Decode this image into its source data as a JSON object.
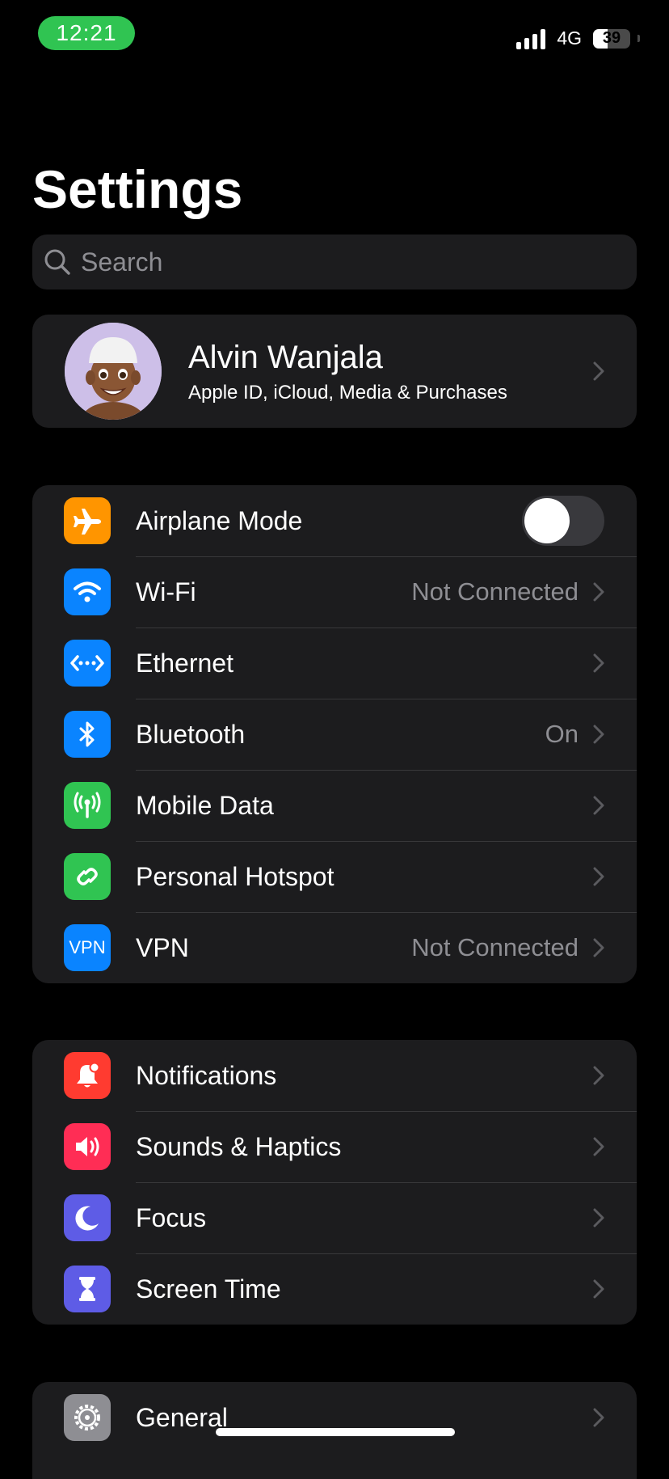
{
  "status_bar": {
    "time": "12:21",
    "network": "4G",
    "battery": "39",
    "battery_level": 0.39,
    "signal_bars": 4
  },
  "title": "Settings",
  "search": {
    "placeholder": "Search"
  },
  "profile": {
    "name": "Alvin Wanjala",
    "subtitle": "Apple ID, iCloud, Media & Purchases"
  },
  "connectivity": [
    {
      "label": "Airplane Mode",
      "value": "",
      "icon": "airplane-icon",
      "color": "#ff9500",
      "toggle": false
    },
    {
      "label": "Wi-Fi",
      "value": "Not Connected",
      "icon": "wifi-icon",
      "color": "#0a84ff"
    },
    {
      "label": "Ethernet",
      "value": "",
      "icon": "ethernet-icon",
      "color": "#0a84ff"
    },
    {
      "label": "Bluetooth",
      "value": "On",
      "icon": "bluetooth-icon",
      "color": "#0a84ff"
    },
    {
      "label": "Mobile Data",
      "value": "",
      "icon": "antenna-icon",
      "color": "#30c452"
    },
    {
      "label": "Personal Hotspot",
      "value": "",
      "icon": "hotspot-icon",
      "color": "#30c452"
    },
    {
      "label": "VPN",
      "value": "Not Connected",
      "icon": "vpn-icon",
      "icon_text": "VPN",
      "color": "#0a84ff"
    }
  ],
  "attention": [
    {
      "label": "Notifications",
      "icon": "bell-icon",
      "color": "#ff3b30"
    },
    {
      "label": "Sounds & Haptics",
      "icon": "speaker-icon",
      "color": "#ff2d55"
    },
    {
      "label": "Focus",
      "icon": "moon-icon",
      "color": "#5e5ce6"
    },
    {
      "label": "Screen Time",
      "icon": "hourglass-icon",
      "color": "#5e5ce6"
    }
  ],
  "system": [
    {
      "label": "General",
      "icon": "gear-icon",
      "color": "#8e8e93"
    }
  ]
}
